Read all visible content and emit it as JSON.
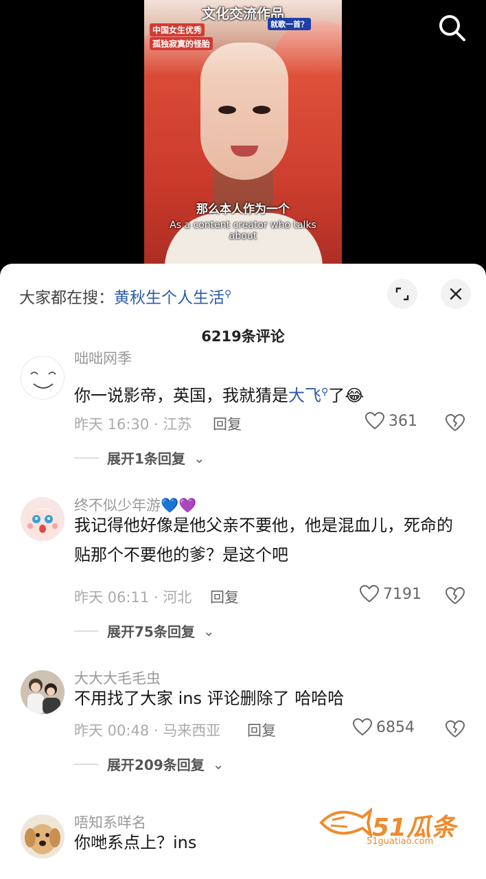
{
  "video": {
    "thumb_title": "文化交流作品",
    "thumb_tag_1": "中国女生优秀",
    "thumb_tag_2": "孤独寂寞的怪胎",
    "thumb_tag_3": "就歌一首？",
    "subtitle_cn": "那么本人作为一个",
    "subtitle_en": "As a content creator who talks about"
  },
  "panel": {
    "hot_search_label": "大家都在搜：",
    "hot_search_keyword": "黄秋生个人生活",
    "comment_count_title": "6219条评论"
  },
  "comments": [
    {
      "username": "咄咄网季",
      "text_before": "你一说影帝，英国，我就猜是",
      "text_keyword": "大飞",
      "text_after": "了😂",
      "time_location": "昨天 16:30 · 江苏",
      "reply": "回复",
      "likes": "361",
      "expand": "展开1条回复"
    },
    {
      "username": "终不似少年游💙💜",
      "text": "我记得他好像是他父亲不要他，他是混血儿，死命的贴那个不要他的爹？是这个吧",
      "time_location": "昨天 06:11 · 河北",
      "reply": "回复",
      "likes": "7191",
      "expand": "展开75条回复"
    },
    {
      "username": "大大大毛毛虫",
      "text": "不用找了大家 ins 评论删除了 哈哈哈",
      "time_location": "昨天 00:48 · 马来西亚",
      "reply": "回复",
      "likes": "6854",
      "expand": "展开209条回复"
    },
    {
      "username": "唔知系咩名",
      "text": "你哋系点上？ins"
    }
  ],
  "watermark": {
    "brand": "51瓜条",
    "url": "51guatiao.com"
  },
  "colors": {
    "keyword": "#2a5caa",
    "watermark": "#f08a2c"
  }
}
